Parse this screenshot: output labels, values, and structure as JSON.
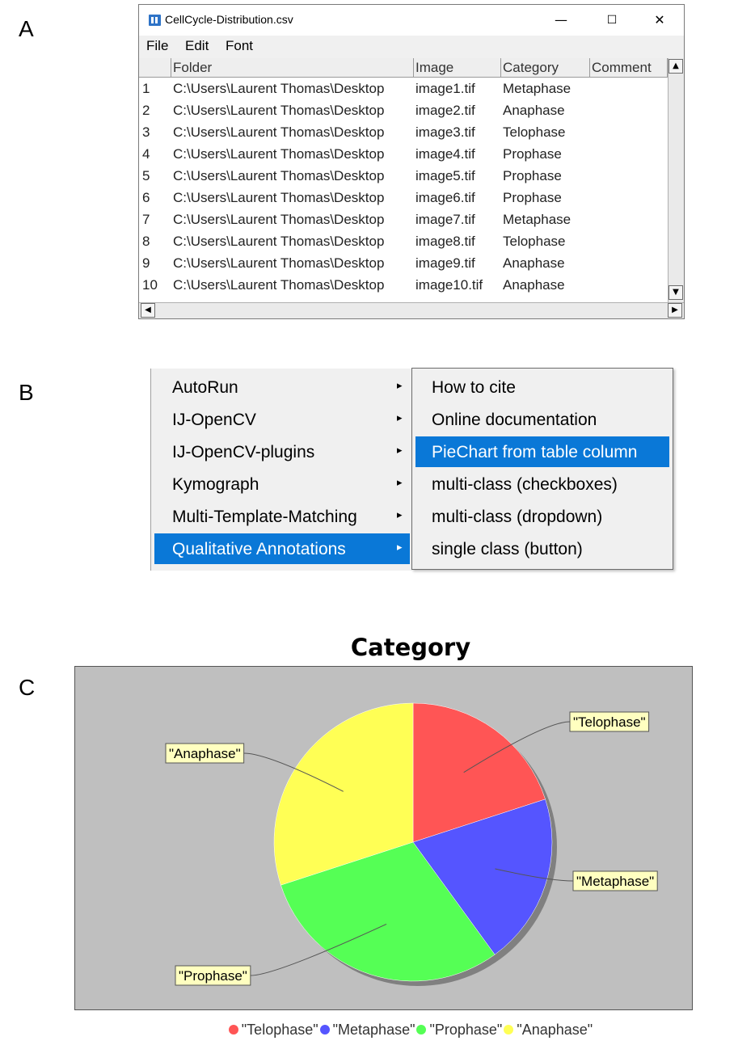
{
  "panel_letters": {
    "a": "A",
    "b": "B",
    "c": "C"
  },
  "window": {
    "title": "CellCycle-Distribution.csv",
    "icon": "imagej-icon",
    "controls": {
      "minimize": "—",
      "maximize": "☐",
      "close": "✕"
    },
    "menus": [
      "File",
      "Edit",
      "Font"
    ],
    "columns": [
      "Folder",
      "Image",
      "Category",
      "Comment"
    ],
    "rows": [
      {
        "n": "1",
        "folder": "C:\\Users\\Laurent Thomas\\Desktop",
        "image": "image1.tif",
        "category": "Metaphase",
        "comment": ""
      },
      {
        "n": "2",
        "folder": "C:\\Users\\Laurent Thomas\\Desktop",
        "image": "image2.tif",
        "category": "Anaphase",
        "comment": ""
      },
      {
        "n": "3",
        "folder": "C:\\Users\\Laurent Thomas\\Desktop",
        "image": "image3.tif",
        "category": "Telophase",
        "comment": ""
      },
      {
        "n": "4",
        "folder": "C:\\Users\\Laurent Thomas\\Desktop",
        "image": "image4.tif",
        "category": "Prophase",
        "comment": ""
      },
      {
        "n": "5",
        "folder": "C:\\Users\\Laurent Thomas\\Desktop",
        "image": "image5.tif",
        "category": "Prophase",
        "comment": ""
      },
      {
        "n": "6",
        "folder": "C:\\Users\\Laurent Thomas\\Desktop",
        "image": "image6.tif",
        "category": "Prophase",
        "comment": ""
      },
      {
        "n": "7",
        "folder": "C:\\Users\\Laurent Thomas\\Desktop",
        "image": "image7.tif",
        "category": "Metaphase",
        "comment": ""
      },
      {
        "n": "8",
        "folder": "C:\\Users\\Laurent Thomas\\Desktop",
        "image": "image8.tif",
        "category": "Telophase",
        "comment": ""
      },
      {
        "n": "9",
        "folder": "C:\\Users\\Laurent Thomas\\Desktop",
        "image": "image9.tif",
        "category": "Anaphase",
        "comment": ""
      },
      {
        "n": "10",
        "folder": "C:\\Users\\Laurent Thomas\\Desktop",
        "image": "image10.tif",
        "category": "Anaphase",
        "comment": ""
      }
    ]
  },
  "menu": {
    "left_items": [
      {
        "label": "AutoRun",
        "selected": false
      },
      {
        "label": "IJ-OpenCV",
        "selected": false
      },
      {
        "label": "IJ-OpenCV-plugins",
        "selected": false
      },
      {
        "label": "Kymograph",
        "selected": false
      },
      {
        "label": "Multi-Template-Matching",
        "selected": false
      },
      {
        "label": "Qualitative Annotations",
        "selected": true
      }
    ],
    "submenu_arrow": "▸",
    "right_items": [
      {
        "label": "How to cite",
        "selected": false
      },
      {
        "label": "Online documentation",
        "selected": false
      },
      {
        "label": "PieChart from table column",
        "selected": true
      },
      {
        "label": "multi-class (checkboxes)",
        "selected": false
      },
      {
        "label": "multi-class (dropdown)",
        "selected": false
      },
      {
        "label": "single class (button)",
        "selected": false
      }
    ],
    "highlight_color": "#0a78d7"
  },
  "chart_data": {
    "type": "pie",
    "title": "Category",
    "categories": [
      "\"Telophase\"",
      "\"Metaphase\"",
      "\"Prophase\"",
      "\"Anaphase\""
    ],
    "values": [
      2,
      2,
      3,
      3
    ],
    "colors": [
      "#ff5555",
      "#5555ff",
      "#55ff55",
      "#ffff55"
    ],
    "legend_position": "bottom",
    "plot_background": "#bfbfbf",
    "label_background": "#ffffc0"
  }
}
